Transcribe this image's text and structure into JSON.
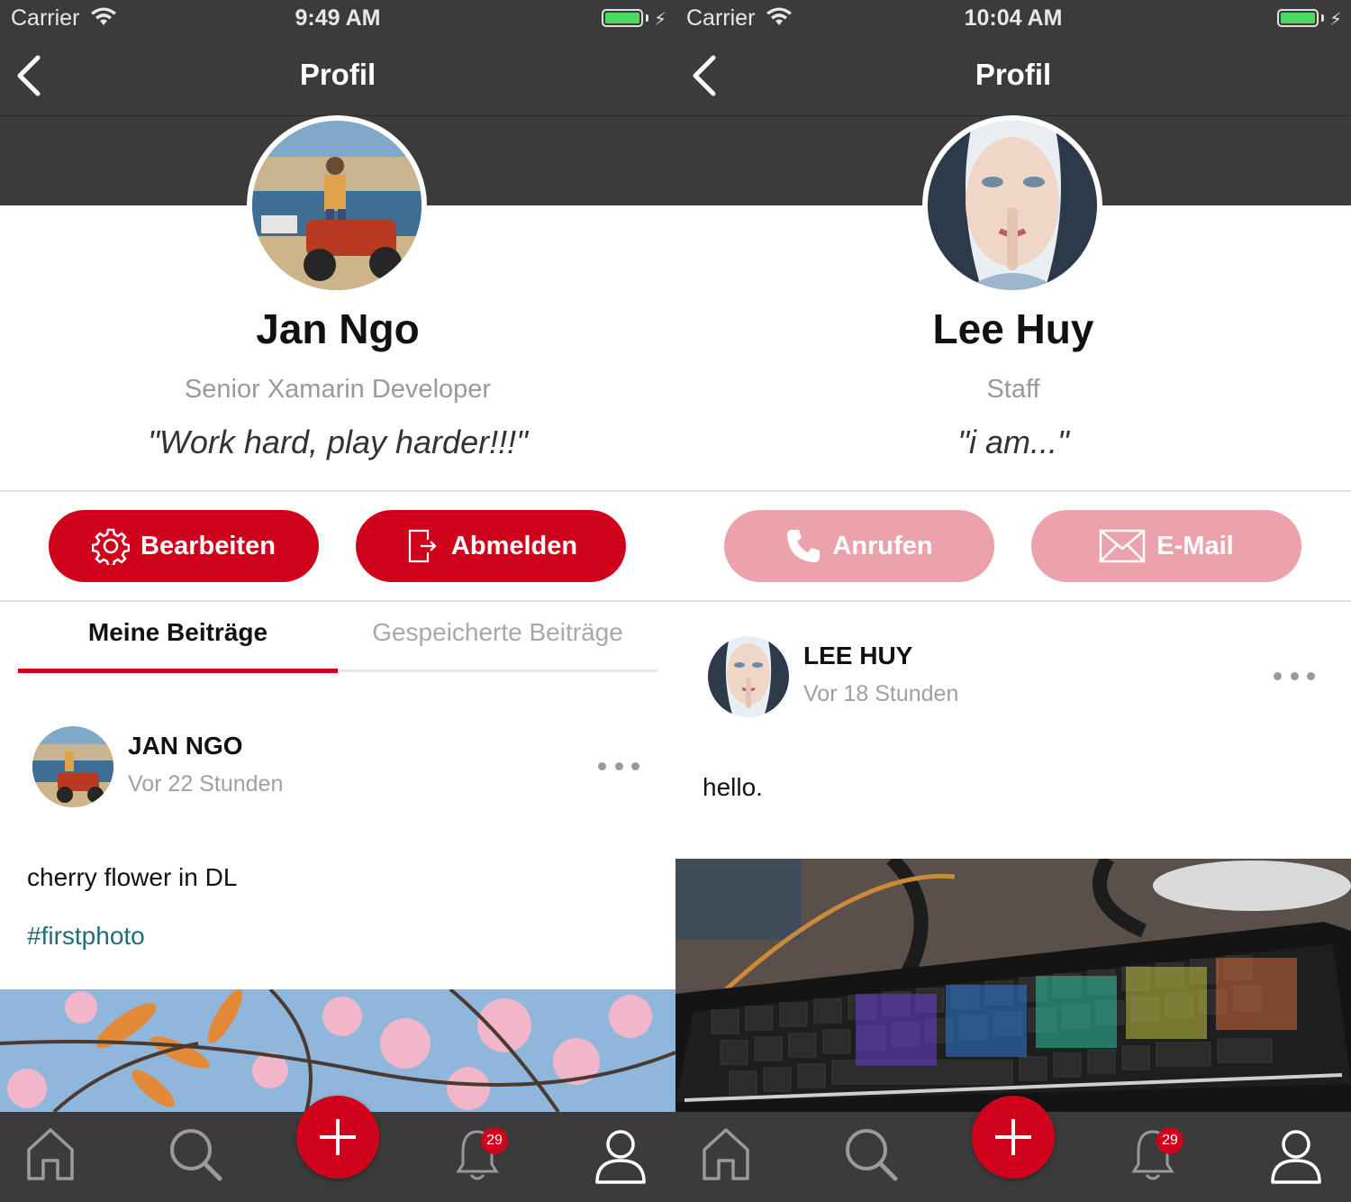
{
  "colors": {
    "header_bg": "#3b3b3b",
    "accent_red": "#d0021b",
    "accent_red_muted": "#eba2aa",
    "hashtag": "#1f6f7a",
    "battery": "#4cd964"
  },
  "left": {
    "status": {
      "carrier": "Carrier",
      "time": "9:49 AM"
    },
    "header": {
      "title": "Profil",
      "back_icon": "chevron-left-icon"
    },
    "profile": {
      "name": "Jan Ngo",
      "role": "Senior Xamarin Developer",
      "quote": "\"Work hard, play harder!!!\""
    },
    "actions": [
      {
        "label": "Bearbeiten",
        "icon": "gear-icon"
      },
      {
        "label": "Abmelden",
        "icon": "logout-icon"
      }
    ],
    "tabs": [
      {
        "label": "Meine Beiträge",
        "active": true
      },
      {
        "label": "Gespeicherte Beiträge",
        "active": false
      }
    ],
    "post": {
      "author": "JAN NGO",
      "time": "Vor 22 Stunden",
      "text": "cherry flower in DL",
      "hashtag": "#firstphoto"
    },
    "tabbar": {
      "badge": "29"
    }
  },
  "right": {
    "status": {
      "carrier": "Carrier",
      "time": "10:04 AM"
    },
    "header": {
      "title": "Profil",
      "back_icon": "chevron-left-icon"
    },
    "profile": {
      "name": "Lee Huy",
      "role": "Staff",
      "quote": "\"i am...\""
    },
    "actions": [
      {
        "label": "Anrufen",
        "icon": "phone-icon"
      },
      {
        "label": "E-Mail",
        "icon": "mail-icon"
      }
    ],
    "post": {
      "author": "LEE HUY",
      "time": "Vor 18 Stunden",
      "text": "hello."
    },
    "tabbar": {
      "badge": "29"
    }
  }
}
